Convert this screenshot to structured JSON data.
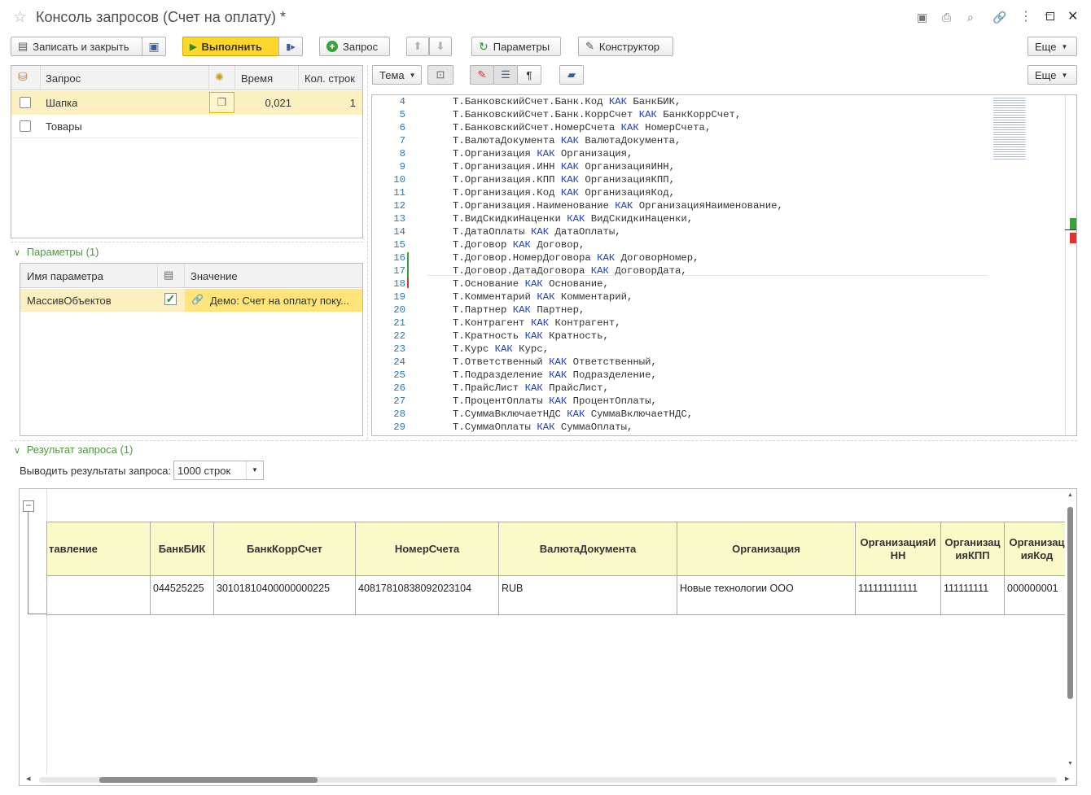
{
  "window": {
    "title": "Консоль запросов (Счет на оплату) *"
  },
  "toolbar": {
    "save_close": "Записать и закрыть",
    "execute": "Выполнить",
    "query": "Запрос",
    "params": "Параметры",
    "constructor": "Конструктор",
    "more": "Еще"
  },
  "queries": {
    "headers": {
      "query": "Запрос",
      "time": "Время",
      "rows": "Кол. строк"
    },
    "rows": [
      {
        "name": "Шапка",
        "time": "0,021",
        "rows": "1"
      },
      {
        "name": "Товары",
        "time": "",
        "rows": ""
      }
    ]
  },
  "parameters": {
    "title": "Параметры (1)",
    "headers": {
      "name": "Имя параметра",
      "value": "Значение"
    },
    "rows": [
      {
        "name": "МассивОбъектов",
        "value": "Демо: Счет на оплату поку..."
      }
    ]
  },
  "editor": {
    "theme": "Тема",
    "more": "Еще",
    "lines": [
      {
        "n": "4",
        "t": [
          "Т.БанковскийСчет.Банк.Код ",
          "КАК",
          " БанкБИК,"
        ]
      },
      {
        "n": "5",
        "t": [
          "Т.БанковскийСчет.Банк.КоррСчет ",
          "КАК",
          " БанкКоррСчет,"
        ]
      },
      {
        "n": "6",
        "t": [
          "Т.БанковскийСчет.НомерСчета ",
          "КАК",
          " НомерСчета,"
        ]
      },
      {
        "n": "7",
        "t": [
          "Т.ВалютаДокумента ",
          "КАК",
          " ВалютаДокумента,"
        ]
      },
      {
        "n": "8",
        "t": [
          "Т.Организация ",
          "КАК",
          " Организация,"
        ]
      },
      {
        "n": "9",
        "t": [
          "Т.Организация.ИНН ",
          "КАК",
          " ОрганизацияИНН,"
        ]
      },
      {
        "n": "10",
        "t": [
          "Т.Организация.КПП ",
          "КАК",
          " ОрганизацияКПП,"
        ]
      },
      {
        "n": "11",
        "t": [
          "Т.Организация.Код ",
          "КАК",
          " ОрганизацияКод,"
        ]
      },
      {
        "n": "12",
        "t": [
          "Т.Организация.Наименование ",
          "КАК",
          " ОрганизацияНаименование,"
        ]
      },
      {
        "n": "13",
        "t": [
          "Т.ВидСкидкиНаценки ",
          "КАК",
          " ВидСкидкиНаценки,"
        ]
      },
      {
        "n": "14",
        "t": [
          "Т.ДатаОплаты ",
          "КАК",
          " ДатаОплаты,"
        ]
      },
      {
        "n": "15",
        "t": [
          "Т.Договор ",
          "КАК",
          " Договор,"
        ]
      },
      {
        "n": "16",
        "t": [
          "Т.Договор.НомерДоговора ",
          "КАК",
          " ДоговорНомер,"
        ]
      },
      {
        "n": "17",
        "t": [
          "Т.Договор.ДатаДоговора ",
          "КАК",
          " ДоговорДата,"
        ]
      },
      {
        "n": "18",
        "t": [
          "Т.Основание ",
          "КАК",
          " Основание,"
        ]
      },
      {
        "n": "19",
        "t": [
          "Т.Комментарий ",
          "КАК",
          " Комментарий,"
        ]
      },
      {
        "n": "20",
        "t": [
          "Т.Партнер ",
          "КАК",
          " Партнер,"
        ]
      },
      {
        "n": "21",
        "t": [
          "Т.Контрагент ",
          "КАК",
          " Контрагент,"
        ]
      },
      {
        "n": "22",
        "t": [
          "Т.Кратность ",
          "КАК",
          " Кратность,"
        ]
      },
      {
        "n": "23",
        "t": [
          "Т.Курс ",
          "КАК",
          " Курс,"
        ]
      },
      {
        "n": "24",
        "t": [
          "Т.Ответственный ",
          "КАК",
          " Ответственный,"
        ]
      },
      {
        "n": "25",
        "t": [
          "Т.Подразделение ",
          "КАК",
          " Подразделение,"
        ]
      },
      {
        "n": "26",
        "t": [
          "Т.ПрайсЛист ",
          "КАК",
          " ПрайсЛист,"
        ]
      },
      {
        "n": "27",
        "t": [
          "Т.ПроцентОплаты ",
          "КАК",
          " ПроцентОплаты,"
        ]
      },
      {
        "n": "28",
        "t": [
          "Т.СуммаВключаетНДС ",
          "КАК",
          " СуммаВключаетНДС,"
        ]
      },
      {
        "n": "29",
        "t": [
          "Т.СуммаОплаты ",
          "КАК",
          " СуммаОплаты,"
        ]
      }
    ]
  },
  "result": {
    "title": "Результат запроса (1)",
    "limit_label": "Выводить результаты запроса:",
    "limit_value": "1000 строк",
    "columns": [
      "тавление",
      "БанкБИК",
      "БанкКоррСчет",
      "НомерСчета",
      "ВалютаДокумента",
      "Организация",
      "ОрганизацияИНН",
      "ОрганизацияКПП",
      "ОрганизацияКод"
    ],
    "column_display": [
      "тавление",
      "БанкБИК",
      "БанкКоррСчет",
      "НомерСчета",
      "ВалютаДокумента",
      "Организация",
      "ОрганизацияИ\nНН",
      "Организац\nияКПП",
      "Организац\nияКод"
    ],
    "row": [
      "",
      "044525225",
      "30101810400000000225",
      "40817810838092023104",
      "RUB",
      "Новые технологии ООО",
      "111111111111",
      "111111111",
      "000000001"
    ]
  },
  "colors": {
    "accent_yellow": "#ffd72a",
    "group_green": "#4b9a3a",
    "keyword_blue": "#1a3bd1",
    "selected_row": "#fcefc0"
  }
}
